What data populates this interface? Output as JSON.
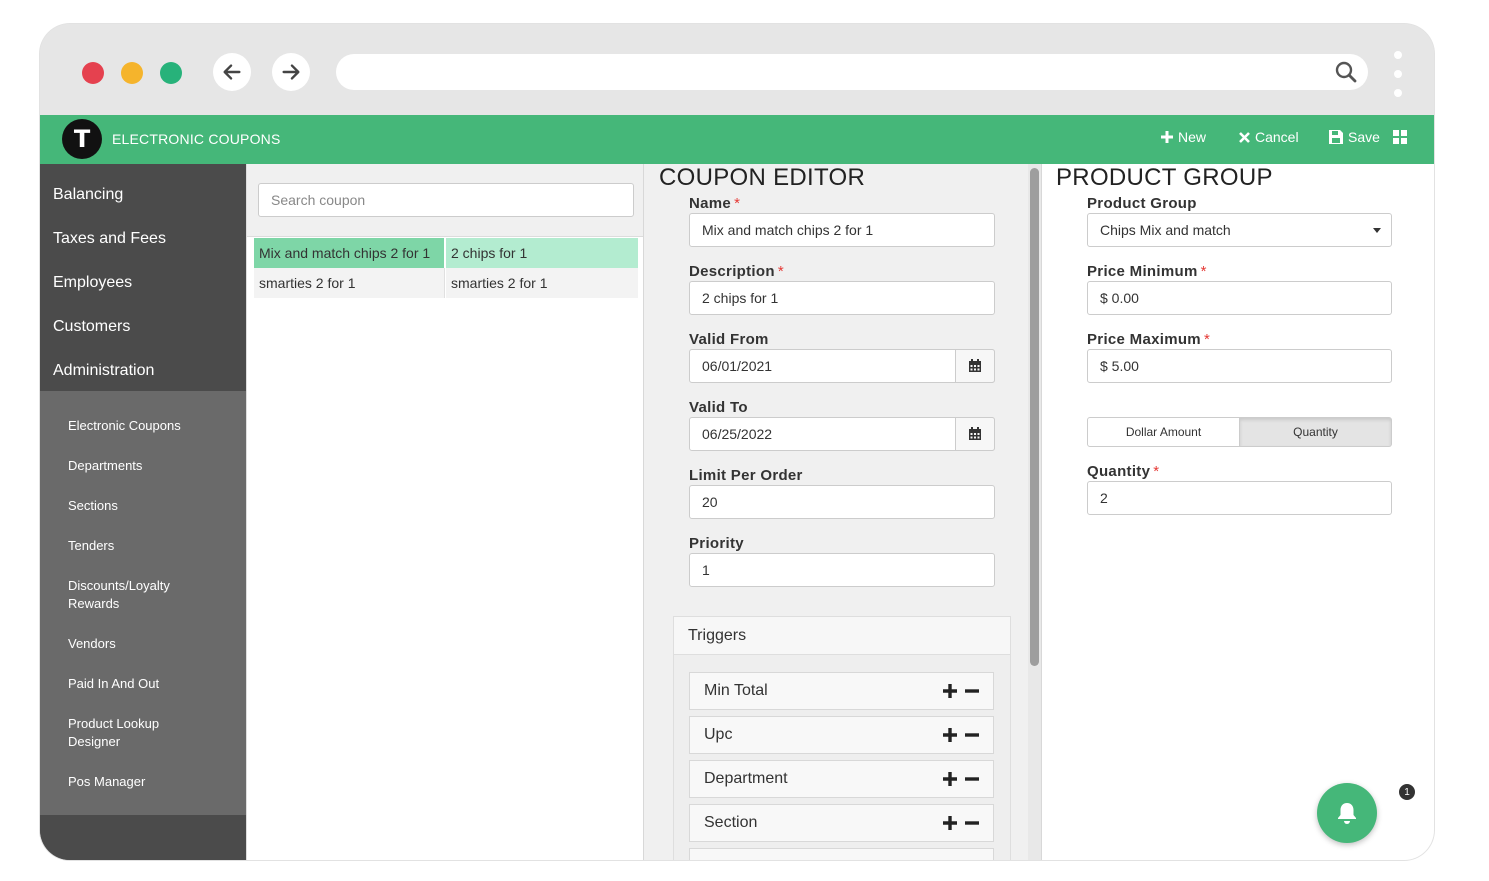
{
  "app": {
    "title": "ELECTRONIC COUPONS",
    "logo_letter": "T"
  },
  "toolbar": {
    "new_label": "New",
    "cancel_label": "Cancel",
    "save_label": "Save"
  },
  "sidebar": {
    "main_items": [
      {
        "label": "Balancing"
      },
      {
        "label": "Taxes and Fees"
      },
      {
        "label": "Employees"
      },
      {
        "label": "Customers"
      },
      {
        "label": "Administration"
      }
    ],
    "sub_items": [
      {
        "label": "Electronic Coupons"
      },
      {
        "label": "Departments"
      },
      {
        "label": "Sections"
      },
      {
        "label": "Tenders"
      },
      {
        "label": "Discounts/Loyalty Rewards"
      },
      {
        "label": "Vendors"
      },
      {
        "label": "Paid In And Out"
      },
      {
        "label": "Product Lookup Designer"
      },
      {
        "label": "Pos Manager"
      }
    ]
  },
  "list": {
    "search_placeholder": "Search coupon",
    "rows": [
      {
        "name": "Mix and match chips 2 for 1",
        "description": "2 chips for 1",
        "selected": true
      },
      {
        "name": "smarties 2 for 1",
        "description": "smarties 2 for 1",
        "selected": false
      }
    ]
  },
  "editor": {
    "title": "COUPON EDITOR",
    "fields": {
      "name": {
        "label": "Name",
        "value": "Mix and match  chips 2 for 1",
        "required": "*"
      },
      "description": {
        "label": "Description",
        "value": "2 chips for 1",
        "required": "*"
      },
      "valid_from": {
        "label": "Valid From",
        "value": "06/01/2021"
      },
      "valid_to": {
        "label": "Valid To",
        "value": "06/25/2022"
      },
      "limit_per_order": {
        "label": "Limit Per Order",
        "value": "20"
      },
      "priority": {
        "label": "Priority",
        "value": "1"
      }
    },
    "triggers": {
      "title": "Triggers",
      "items": [
        {
          "label": "Min Total"
        },
        {
          "label": "Upc"
        },
        {
          "label": "Department"
        },
        {
          "label": "Section"
        }
      ]
    }
  },
  "product_group": {
    "title": "PRODUCT GROUP",
    "group": {
      "label": "Product Group",
      "value": "Chips Mix and match"
    },
    "price_min": {
      "label": "Price Minimum",
      "value": "$ 0.00",
      "required": "*"
    },
    "price_max": {
      "label": "Price Maximum",
      "value": "$ 5.00",
      "required": "*"
    },
    "mode": {
      "option1": "Dollar Amount",
      "option2": "Quantity",
      "selected": "Quantity"
    },
    "quantity": {
      "label": "Quantity",
      "value": "2",
      "required": "*"
    }
  },
  "notifications": {
    "count": "1"
  },
  "colors": {
    "brand": "#45b779",
    "selected_row": "#7ed6a7",
    "required": "#e53935"
  }
}
